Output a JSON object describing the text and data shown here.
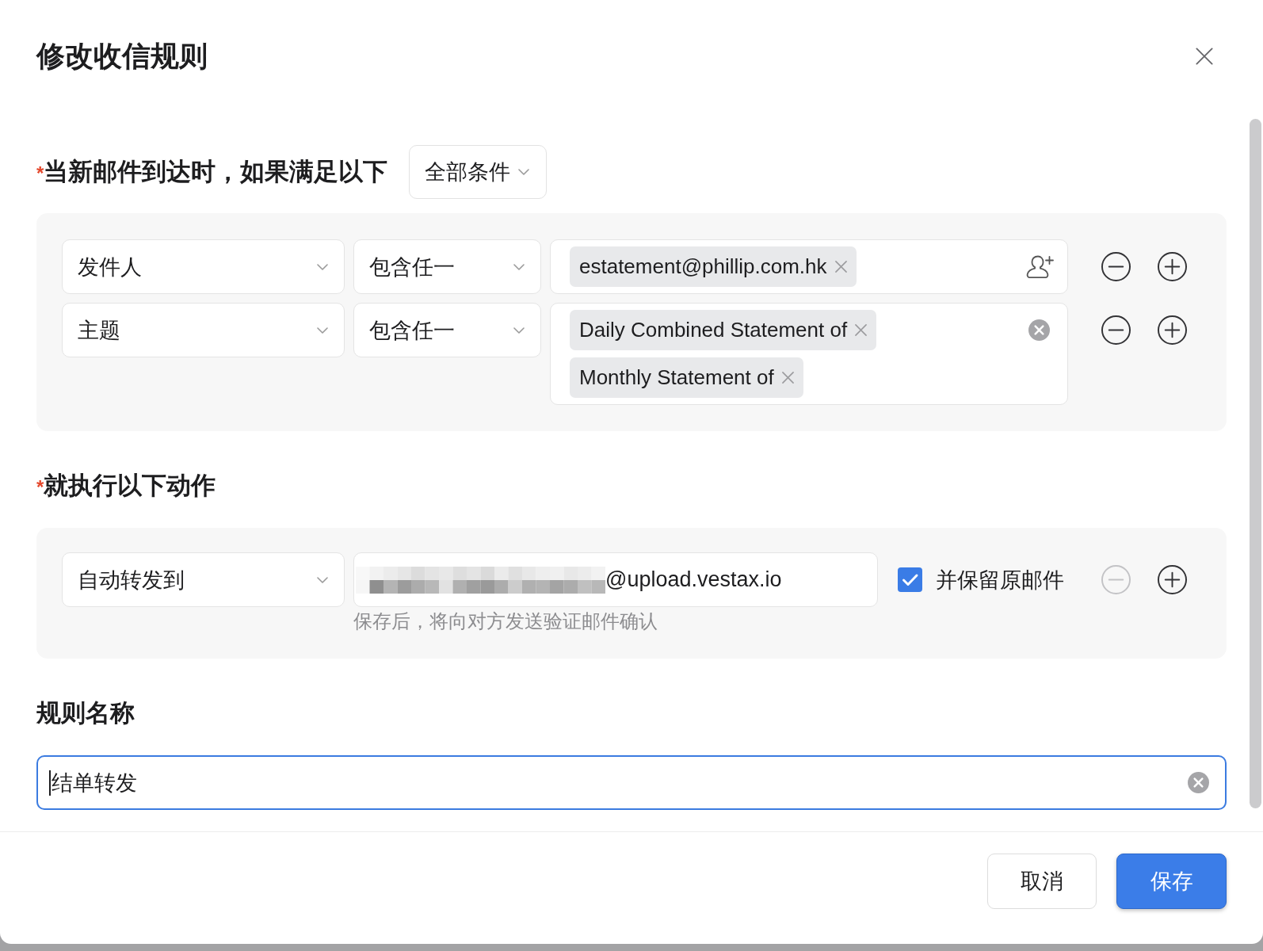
{
  "dialog": {
    "title": "修改收信规则"
  },
  "conditions": {
    "required_mark": "*",
    "label": "当新邮件到达时，如果满足以下",
    "match_mode": "全部条件",
    "rows": [
      {
        "kind": "address",
        "field": "发件人",
        "operator": "包含任一",
        "values": [
          "estatement@phillip.com.hk"
        ],
        "remove_disabled": false
      },
      {
        "kind": "keyword",
        "field": "主题",
        "operator": "包含任一",
        "values": [
          "Daily Combined Statement of",
          "Monthly Statement of"
        ],
        "remove_disabled": false
      }
    ]
  },
  "actions": {
    "required_mark": "*",
    "label": "就执行以下动作",
    "rows": [
      {
        "action": "自动转发到",
        "address": {
          "value": "@upload.vestax.io",
          "redacted": true
        },
        "hint": "保存后，将向对方发送验证邮件确认",
        "keep_original": {
          "label": "并保留原邮件",
          "checked": true
        },
        "remove_disabled": true
      }
    ]
  },
  "rule_name": {
    "label": "规则名称",
    "value": "结单转发",
    "focused": true
  },
  "buttons": [
    {
      "label": "取消",
      "kind": "default"
    },
    {
      "label": "保存",
      "kind": "primary"
    }
  ]
}
